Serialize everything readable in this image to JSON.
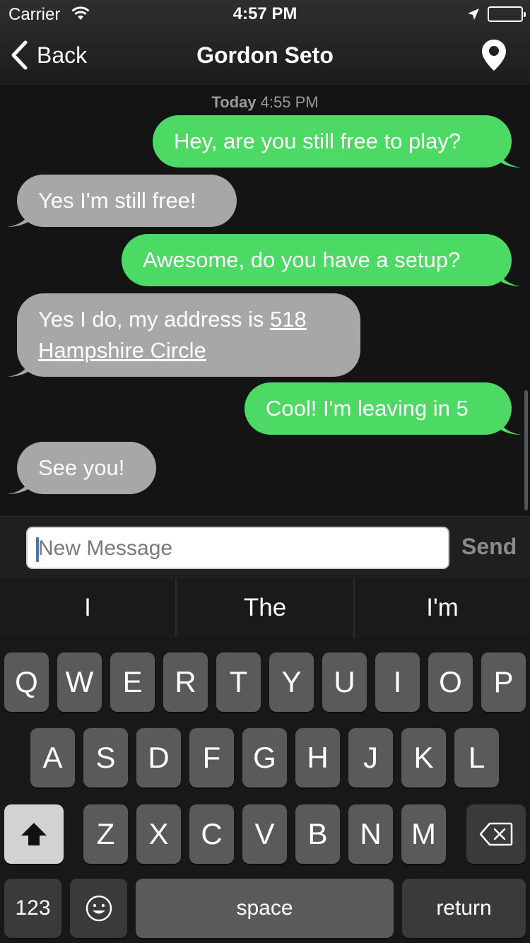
{
  "status_bar": {
    "carrier": "Carrier",
    "time": "4:57 PM"
  },
  "nav": {
    "back_label": "Back",
    "title": "Gordon Seto"
  },
  "messages": {
    "timestamp_day": "Today",
    "timestamp_time": "4:55 PM",
    "items": [
      {
        "dir": "out",
        "text": "Hey, are you still free to play?"
      },
      {
        "dir": "in",
        "text": "Yes I'm still free!"
      },
      {
        "dir": "out",
        "text": "Awesome, do you have a setup?"
      },
      {
        "dir": "in",
        "text_before": "Yes I do, my address is ",
        "link_line1": "518",
        "link_line2": "Hampshire Circle"
      },
      {
        "dir": "out",
        "text": "Cool! I'm leaving in 5"
      },
      {
        "dir": "in",
        "text": "See you!"
      }
    ]
  },
  "composer": {
    "placeholder": "New Message",
    "send_label": "Send"
  },
  "keyboard": {
    "suggestions": [
      "I",
      "The",
      "I'm"
    ],
    "row1": [
      "Q",
      "W",
      "E",
      "R",
      "T",
      "Y",
      "U",
      "I",
      "O",
      "P"
    ],
    "row2": [
      "A",
      "S",
      "D",
      "F",
      "G",
      "H",
      "J",
      "K",
      "L"
    ],
    "row3": [
      "Z",
      "X",
      "C",
      "V",
      "B",
      "N",
      "M"
    ],
    "numbers_label": "123",
    "space_label": "space",
    "return_label": "return"
  },
  "colors": {
    "outgoing_bubble": "#4cd964",
    "incoming_bubble": "#a7a7a7",
    "caret": "#3d73d9"
  }
}
